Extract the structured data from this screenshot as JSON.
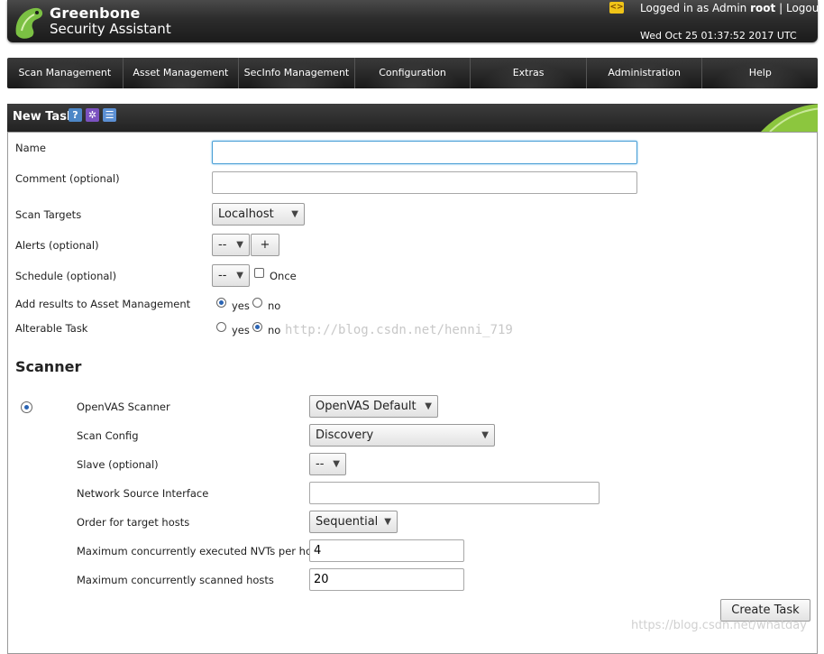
{
  "header": {
    "brand_line1": "Greenbone",
    "brand_line2": "Security Assistant",
    "login_prefix": "Logged in as Admin",
    "user": "root",
    "separator": "|",
    "logout": "Logout",
    "datetime": "Wed Oct 25 01:37:52 2017 UTC",
    "language_icon": "<>"
  },
  "nav": [
    "Scan Management",
    "Asset Management",
    "SecInfo Management",
    "Configuration",
    "Extras",
    "Administration",
    "Help"
  ],
  "section": {
    "title": "New Task",
    "icons": [
      "help-icon",
      "wizard-icon",
      "list-icon"
    ]
  },
  "form": {
    "name_label": "Name",
    "name_value": "",
    "comment_label": "Comment (optional)",
    "comment_value": "",
    "targets_label": "Scan Targets",
    "targets_value": "Localhost",
    "alerts_label": "Alerts (optional)",
    "alerts_value": "--",
    "alerts_add": "+",
    "schedule_label": "Schedule (optional)",
    "schedule_value": "--",
    "once_label": "Once",
    "add_results_label": "Add results to Asset Management",
    "alterable_label": "Alterable Task",
    "yes": "yes",
    "no": "no"
  },
  "scanner": {
    "heading": "Scanner",
    "openvas_label": "OpenVAS Scanner",
    "openvas_value": "OpenVAS Default",
    "config_label": "Scan Config",
    "config_value": "Discovery",
    "slave_label": "Slave (optional)",
    "slave_value": "--",
    "netif_label": "Network Source Interface",
    "netif_value": "",
    "order_label": "Order for target hosts",
    "order_value": "Sequential",
    "max_nvts_label": "Maximum concurrently executed NVTs per host",
    "max_nvts_value": "4",
    "max_hosts_label": "Maximum concurrently scanned hosts",
    "max_hosts_value": "20"
  },
  "create_button": "Create Task",
  "watermarks": {
    "center": "http://blog.csdn.net/henni_719",
    "corner": "https://blog.csdn.net/whatday"
  }
}
